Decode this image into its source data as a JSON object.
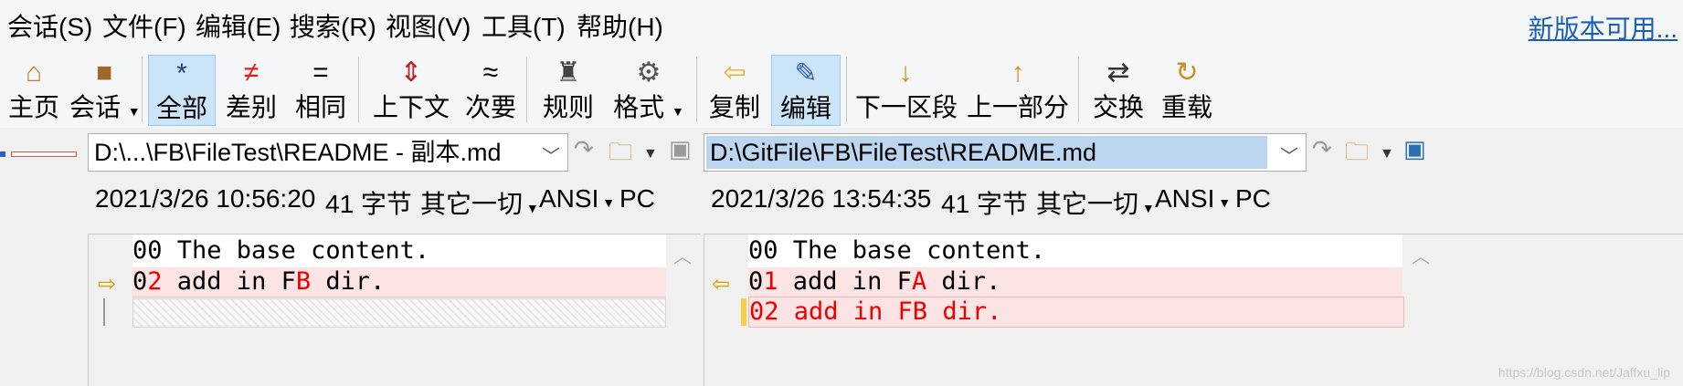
{
  "menu": [
    "会话(S)",
    "文件(F)",
    "编辑(E)",
    "搜索(R)",
    "视图(V)",
    "工具(T)",
    "帮助(H)"
  ],
  "new_version": "新版本可用...",
  "toolbar": {
    "home": "主页",
    "session": "会话",
    "all": "全部",
    "diffs": "差别",
    "same": "相同",
    "context": "上下文",
    "minor": "次要",
    "rules": "规则",
    "format": "格式",
    "copy": "复制",
    "edit": "编辑",
    "next_section": "下一区段",
    "prev_section": "上一部分",
    "swap": "交换",
    "reload": "重载"
  },
  "left": {
    "path": "D:\\...\\FB\\FileTest\\README - 副本.md",
    "info": {
      "date": "2021/3/26 10:56:20",
      "size": "41 字节",
      "enc_type": "其它一切",
      "charset": "ANSI",
      "eol": "PC"
    },
    "lines": [
      {
        "num": "00",
        "text": " The base content."
      },
      {
        "num_a": "0",
        "num_b": "2",
        "text_a": " add in F",
        "text_b": "B",
        "text_c": " dir."
      }
    ]
  },
  "right": {
    "path": "D:\\GitFile\\FB\\FileTest\\README.md",
    "info": {
      "date": "2021/3/26 13:54:35",
      "size": "41 字节",
      "enc_type": "其它一切",
      "charset": "ANSI",
      "eol": "PC"
    },
    "lines": [
      {
        "num": "00",
        "text": " The base content."
      },
      {
        "num_a": "0",
        "num_b": "1",
        "text_a": " add in F",
        "text_b": "A",
        "text_c": " dir."
      },
      {
        "text": "02 add in FB dir."
      }
    ]
  },
  "watermark": "https://blog.csdn.net/Jaffxu_lip",
  "colors": {
    "diff_bg": "#fde4e4",
    "diff_text": "#e00000",
    "link": "#1a5fb4",
    "active_btn": "#cce4f7"
  }
}
